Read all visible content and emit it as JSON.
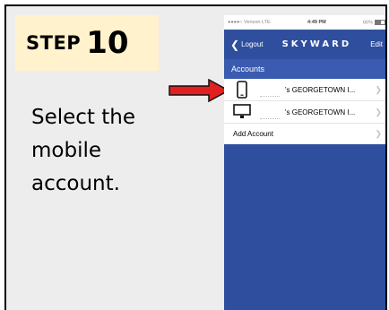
{
  "slide": {
    "step_word": "STEP",
    "step_number": "10",
    "instruction_lines": [
      "Select the",
      "mobile",
      "account."
    ]
  },
  "phone": {
    "status": {
      "carrier": "●●●●○ Verizon LTE",
      "time": "4:49 PM",
      "battery": "66%"
    },
    "navbar": {
      "back_label": "Logout",
      "brand": "SKYWARD",
      "edit_label": "Edit"
    },
    "section_header": "Accounts",
    "accounts": [
      {
        "icon": "mobile-phone-icon",
        "name": "'s GEORGETOWN I..."
      },
      {
        "icon": "desktop-monitor-icon",
        "name": "'s GEORGETOWN I..."
      }
    ],
    "add_account_label": "Add Account"
  },
  "colors": {
    "step_box_bg": "#fff2cc",
    "arrow_red": "#e02020",
    "skyward_blue": "#2f4f9e",
    "section_blue": "#3a5bb0"
  }
}
